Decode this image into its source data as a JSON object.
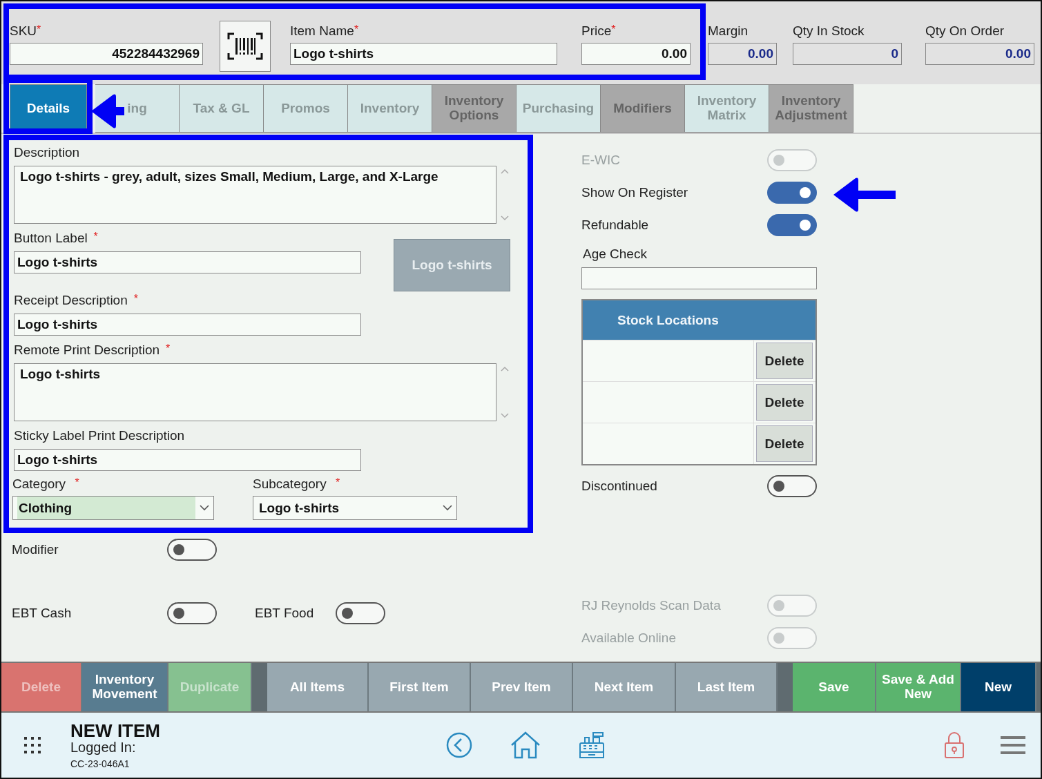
{
  "header": {
    "fields": [
      {
        "label": "SKU",
        "required_mark": "*",
        "value": "452284432969",
        "readonly": false
      },
      {
        "label": "Item Name",
        "required_mark": "*",
        "value": "Logo t-shirts",
        "readonly": false
      },
      {
        "label": "Price",
        "required_mark": "*",
        "value": "0.00",
        "readonly": false
      },
      {
        "label": "Margin",
        "value": "0.00",
        "readonly": true
      },
      {
        "label": "Qty In Stock",
        "value": "0",
        "readonly": true
      },
      {
        "label": "Qty On Order",
        "value": "0.00",
        "readonly": true
      }
    ]
  },
  "tabs": [
    {
      "label": "Details",
      "selected": true,
      "disabled": false
    },
    {
      "label": "ing",
      "selected": false,
      "disabled": false
    },
    {
      "label": "Tax & GL",
      "selected": false,
      "disabled": false
    },
    {
      "label": "Promos",
      "selected": false,
      "disabled": false
    },
    {
      "label": "Inventory",
      "selected": false,
      "disabled": false
    },
    {
      "label": "Inventory Options",
      "selected": false,
      "disabled": true
    },
    {
      "label": "Purchasing",
      "selected": false,
      "disabled": false
    },
    {
      "label": "Modifiers",
      "selected": false,
      "disabled": true
    },
    {
      "label": "Inventory Matrix",
      "selected": false,
      "disabled": false
    },
    {
      "label": "Inventory Adjustment",
      "selected": false,
      "disabled": true
    }
  ],
  "details": {
    "description": {
      "label": "Description",
      "value": "Logo t-shirts - grey, adult, sizes Small, Medium, Large, and X-Large"
    },
    "button_label": {
      "label": "Button Label",
      "required_mark": "*",
      "value": "Logo t-shirts"
    },
    "button_preview": "Logo t-shirts",
    "receipt_description": {
      "label": "Receipt Description",
      "required_mark": "*",
      "value": "Logo t-shirts"
    },
    "remote_print_description": {
      "label": "Remote Print Description",
      "required_mark": "*",
      "value": "Logo t-shirts"
    },
    "sticky_label_print_description": {
      "label": "Sticky Label Print Description",
      "value": "Logo t-shirts"
    },
    "category": {
      "label": "Category",
      "required_mark": "*",
      "value": "Clothing",
      "highlighted": true
    },
    "subcategory": {
      "label": "Subcategory",
      "required_mark": "*",
      "value": "Logo t-shirts",
      "highlighted": false
    }
  },
  "left_toggles": [
    {
      "label": "Modifier",
      "on": false,
      "disabled": false
    },
    {
      "label": "EBT Cash",
      "on": false,
      "disabled": false
    },
    {
      "label": "EBT Food",
      "on": false,
      "disabled": false
    }
  ],
  "right_toggles_top": [
    {
      "label": "E-WIC",
      "on": false,
      "disabled": true
    },
    {
      "label": "Show On Register",
      "on": true,
      "disabled": false
    },
    {
      "label": "Refundable",
      "on": true,
      "disabled": false
    }
  ],
  "age_check": {
    "label": "Age Check"
  },
  "stock_locations": {
    "title": "Stock Locations",
    "rows": [
      {
        "button": "Delete"
      },
      {
        "button": "Delete"
      },
      {
        "button": "Delete"
      }
    ]
  },
  "discontinued": {
    "label": "Discontinued",
    "on": false,
    "disabled": false
  },
  "right_toggles_bottom": [
    {
      "label": "RJ Reynolds Scan Data",
      "on": false,
      "disabled": true
    },
    {
      "label": "Available Online",
      "on": false,
      "disabled": true
    }
  ],
  "actions": [
    {
      "label": "Delete",
      "color": "#d9736f",
      "disabled": true
    },
    {
      "label": "Inventory Movement",
      "color": "#587c90",
      "disabled": false
    },
    {
      "label": "Duplicate",
      "color": "#86c190",
      "disabled": true
    },
    {
      "kind": "spacer"
    },
    {
      "label": "All Items",
      "color": "#98a8b0",
      "disabled": false
    },
    {
      "label": "First Item",
      "color": "#98a8b0",
      "disabled": false
    },
    {
      "label": "Prev Item",
      "color": "#98a8b0",
      "disabled": false
    },
    {
      "label": "Next Item",
      "color": "#98a8b0",
      "disabled": false
    },
    {
      "label": "Last Item",
      "color": "#98a8b0",
      "disabled": false
    },
    {
      "kind": "spacer"
    },
    {
      "label": "Save",
      "color": "#5bb46e",
      "disabled": false
    },
    {
      "label": "Save & Add New",
      "color": "#5bb46e",
      "disabled": false
    },
    {
      "label": "New",
      "color": "#003f6a",
      "disabled": false
    }
  ],
  "footer": {
    "title": "NEW ITEM",
    "logged_in": "Logged In:",
    "terminal": "CC-23-046A1"
  },
  "annotations": [
    {
      "kind": "box"
    },
    {
      "kind": "box"
    },
    {
      "kind": "box"
    },
    {
      "kind": "arrow"
    },
    {
      "kind": "arrow"
    }
  ]
}
